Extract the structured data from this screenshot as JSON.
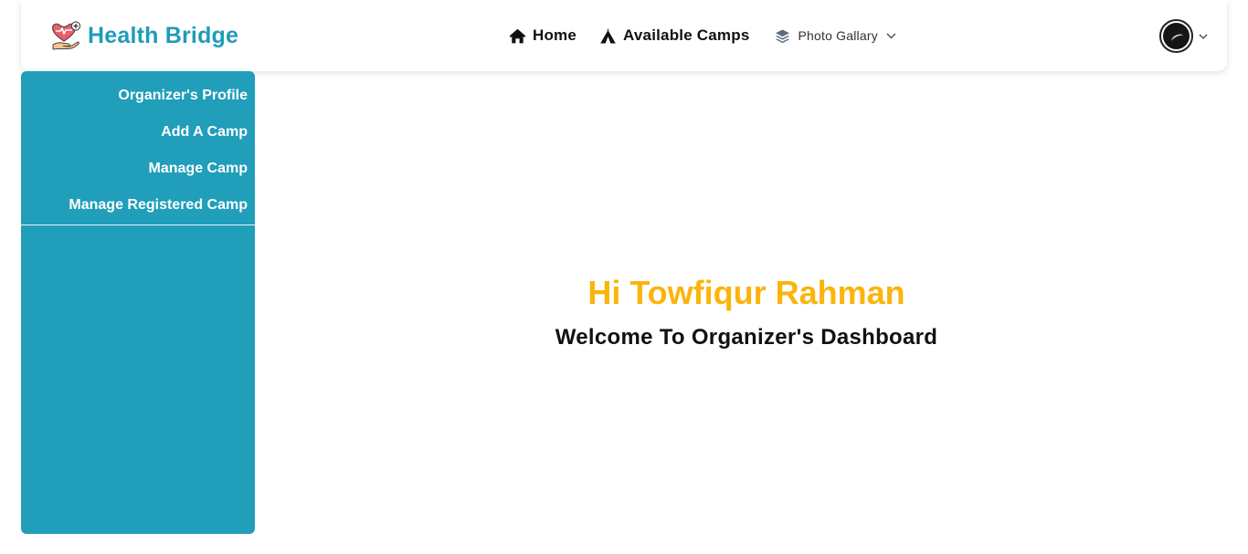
{
  "header": {
    "brand_name": "Health Bridge",
    "brand_icon": "heart-hand-icon",
    "nav": [
      {
        "label": "Home",
        "icon": "home-icon"
      },
      {
        "label": "Available Camps",
        "icon": "tent-icon"
      },
      {
        "label": "Photo Gallary",
        "icon": "layers-icon"
      }
    ],
    "user_avatar": "avatar"
  },
  "sidebar": {
    "items": [
      {
        "label": "Organizer's Profile"
      },
      {
        "label": "Add A Camp"
      },
      {
        "label": "Manage Camp"
      },
      {
        "label": "Manage Registered Camp"
      }
    ]
  },
  "main": {
    "greeting": "Hi Towfiqur Rahman",
    "welcome": "Welcome To Organizer's Dashboard"
  },
  "colors": {
    "brand": "#1f9cb9",
    "sidebar_bg": "#209eba",
    "greeting": "#fbb40c",
    "text_dark": "#111111"
  }
}
